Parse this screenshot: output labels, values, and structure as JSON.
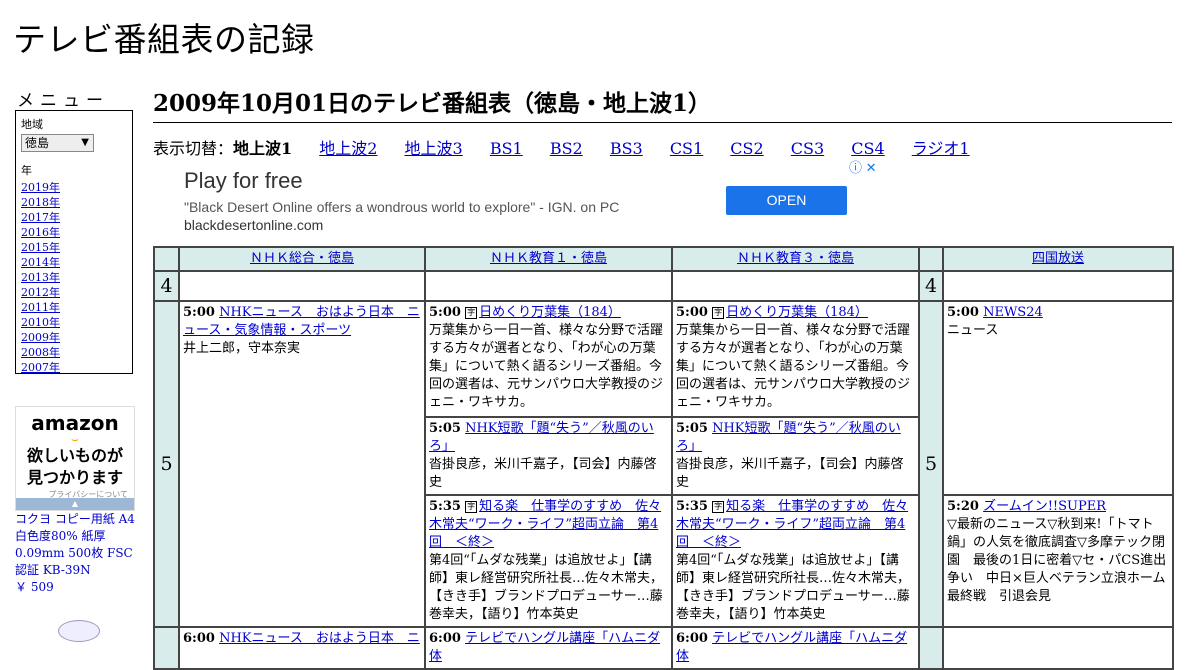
{
  "site_title": "テレビ番組表の記録",
  "menu": {
    "heading": "メニュー",
    "region_label": "地域",
    "region_value": "徳島",
    "year_label": "年",
    "years": [
      "2019年",
      "2018年",
      "2017年",
      "2016年",
      "2015年",
      "2014年",
      "2013年",
      "2012年",
      "2011年",
      "2010年",
      "2009年",
      "2008年",
      "2007年"
    ]
  },
  "amazon_ad": {
    "logo": "amazon",
    "message_line1": "欲しいものが",
    "message_line2": "見つかります",
    "privacy": "プライバシーについて"
  },
  "product": {
    "name": "コクヨ コピー用紙 A4 白色度80% 紙厚 0.09mm 500枚 FSC認証 KB-39N",
    "price": "￥ 509"
  },
  "page_title": "2009年10月01日のテレビ番組表（徳島・地上波1）",
  "switcher": {
    "label": "表示切替：",
    "current": "地上波1",
    "links": [
      "地上波2",
      "地上波3",
      "BS1",
      "BS2",
      "BS3",
      "CS1",
      "CS2",
      "CS3",
      "CS4",
      "ラジオ1"
    ]
  },
  "ad": {
    "headline": "Play for free",
    "quote": "\"Black Desert Online offers a wondrous world to explore\" - IGN. on PC",
    "url": "blackdesertonline.com",
    "button": "OPEN"
  },
  "channels": [
    "ＮＨＫ総合・徳島",
    "ＮＨＫ教育１・徳島",
    "ＮＨＫ教育３・徳島",
    "四国放送"
  ],
  "hours": [
    "4",
    "5"
  ],
  "programs": {
    "nhk_g": {
      "p1": {
        "time": "5:00",
        "title": "NHKニュース　おはよう日本　ニュース・気象情報・スポーツ",
        "desc": "井上二郎，守本奈実"
      },
      "p2": {
        "time": "6:00",
        "title": "NHKニュース　おはよう日本　ニ"
      }
    },
    "nhk_e1": {
      "p1": {
        "time": "5:00",
        "title": "日めくり万葉集（184）",
        "desc": "万葉集から一日一首、様々な分野で活躍する方々が選者となり、「わが心の万葉集」について熱く語るシリーズ番組。今回の選者は、元サンパウロ大学教授のジェニ・ワキサカ。"
      },
      "p2": {
        "time": "5:05",
        "title": "NHK短歌「題“失う”／秋風のいろ」",
        "desc": "沓掛良彦，米川千嘉子，【司会】内藤啓史"
      },
      "p3": {
        "time": "5:35",
        "title": "知る楽　仕事学のすすめ　佐々木常夫“ワーク・ライフ”超両立論　第4回　＜終＞",
        "desc": "第4回“「ムダな残業」は追放せよ」【講師】東レ経営研究所社長…佐々木常夫，【きき手】ブランドプロデューサー…藤巻幸夫，【語り】竹本英史"
      },
      "p4": {
        "time": "6:00",
        "title": "テレビでハングル講座「ハムニダ体"
      }
    },
    "nhk_e3": {
      "p1": {
        "time": "5:00",
        "title": "日めくり万葉集（184）",
        "desc": "万葉集から一日一首、様々な分野で活躍する方々が選者となり、「わが心の万葉集」について熱く語るシリーズ番組。今回の選者は、元サンパウロ大学教授のジェニ・ワキサカ。"
      },
      "p2": {
        "time": "5:05",
        "title": "NHK短歌「題“失う”／秋風のいろ」",
        "desc": "沓掛良彦，米川千嘉子，【司会】内藤啓史"
      },
      "p3": {
        "time": "5:35",
        "title": "知る楽　仕事学のすすめ　佐々木常夫“ワーク・ライフ”超両立論　第4回　＜終＞",
        "desc": "第4回“「ムダな残業」は追放せよ」【講師】東レ経営研究所社長…佐々木常夫，【きき手】ブランドプロデューサー…藤巻幸夫，【語り】竹本英史"
      },
      "p4": {
        "time": "6:00",
        "title": "テレビでハングル講座「ハムニダ体"
      }
    },
    "shikoku": {
      "p1": {
        "time": "5:00",
        "title": "NEWS24",
        "desc": "ニュース"
      },
      "p2": {
        "time": "5:20",
        "title": "ズームイン!!SUPER",
        "desc": "▽最新のニュース▽秋到来!「トマト鍋」の人気を徹底調査▽多摩テック閉園　最後の1日に密着▽セ・パCS進出争い　中日×巨人ベテラン立浪ホーム最終戦　引退会見"
      }
    }
  }
}
